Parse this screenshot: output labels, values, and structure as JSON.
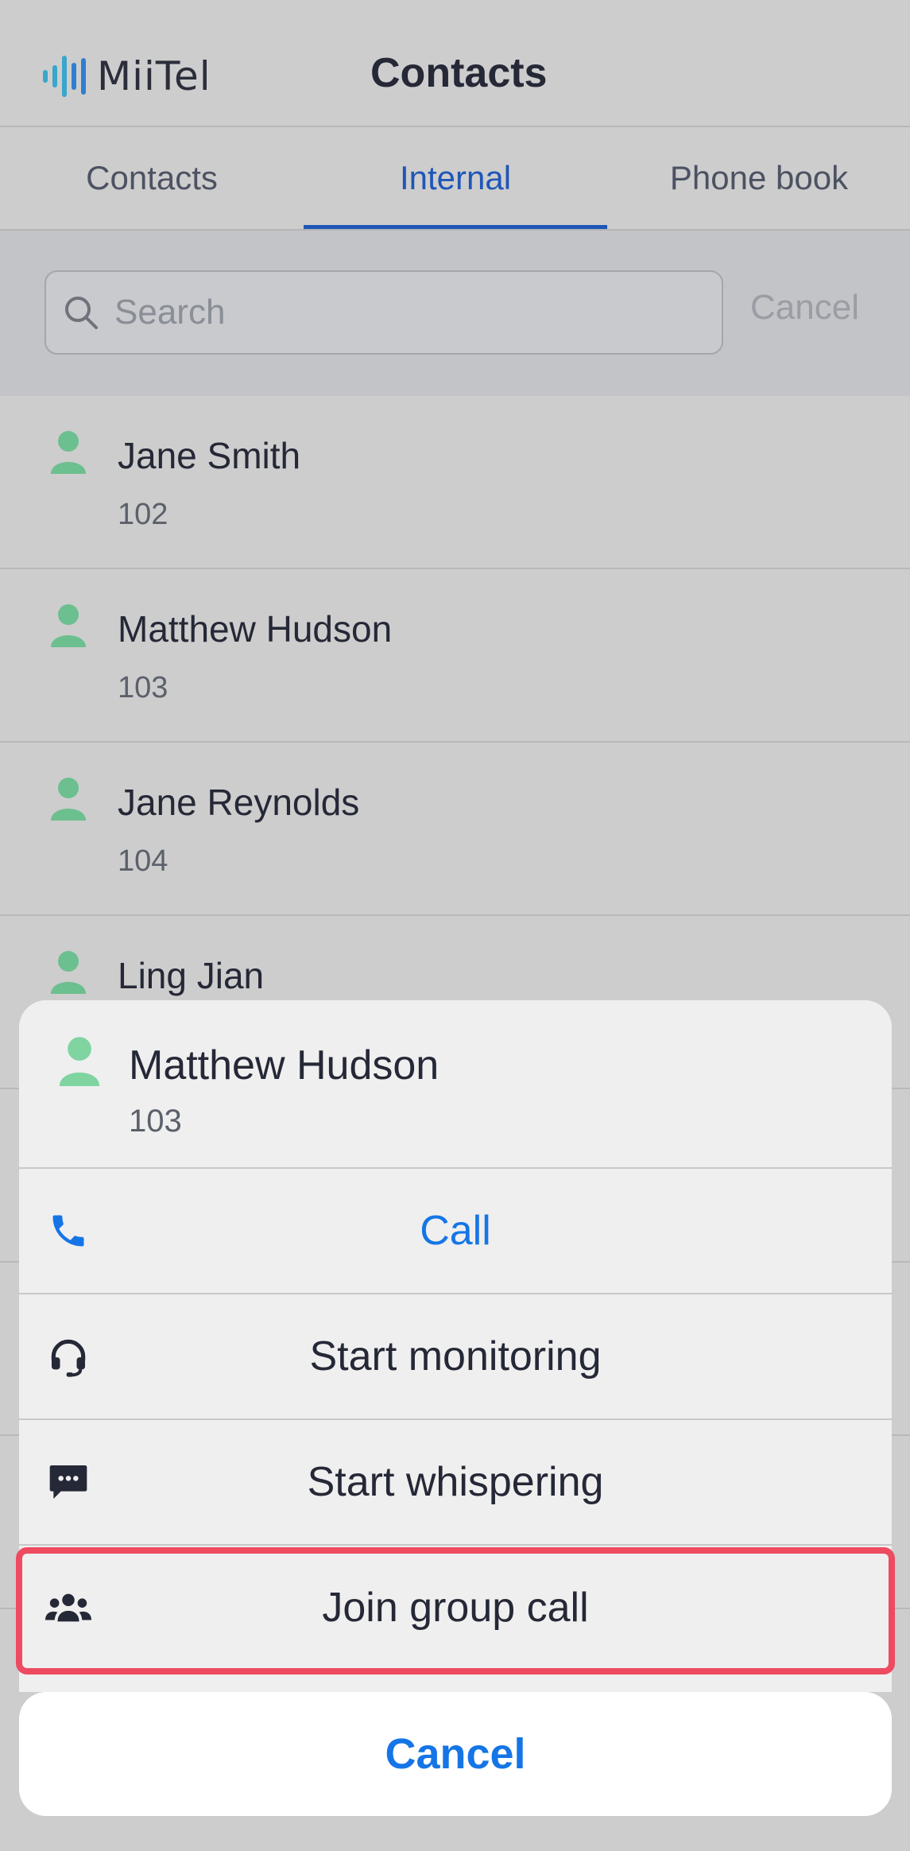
{
  "header": {
    "logo_text": "MiiTel",
    "title": "Contacts"
  },
  "tabs": [
    {
      "label": "Contacts",
      "active": false
    },
    {
      "label": "Internal",
      "active": true
    },
    {
      "label": "Phone book",
      "active": false
    }
  ],
  "search": {
    "placeholder": "Search",
    "value": "",
    "cancel_label": "Cancel"
  },
  "contacts": [
    {
      "name": "Jane Smith",
      "ext": "102"
    },
    {
      "name": "Matthew Hudson",
      "ext": "103"
    },
    {
      "name": "Jane Reynolds",
      "ext": "104"
    },
    {
      "name": "Ling Jian",
      "ext": ""
    }
  ],
  "sheet": {
    "contact": {
      "name": "Matthew Hudson",
      "ext": "103"
    },
    "actions": [
      {
        "label": "Call",
        "icon": "phone-icon"
      },
      {
        "label": "Start monitoring",
        "icon": "headset-icon"
      },
      {
        "label": "Start whispering",
        "icon": "chat-bubble-icon"
      },
      {
        "label": "Join group call",
        "icon": "group-icon"
      }
    ],
    "cancel_label": "Cancel"
  },
  "colors": {
    "accent": "#1f56b7",
    "action_blue": "#1575e6",
    "person_icon": "#6cbf8e",
    "highlight": "#ee4a60"
  }
}
